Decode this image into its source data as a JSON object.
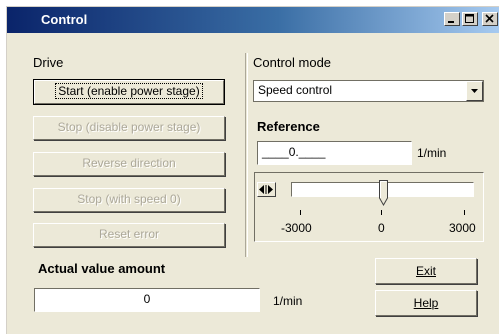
{
  "window": {
    "title": "Control"
  },
  "drive": {
    "heading": "Drive",
    "buttons": [
      {
        "label": "Start (enable power stage)",
        "enabled": true
      },
      {
        "label": "Stop (disable power stage)",
        "enabled": false
      },
      {
        "label": "Reverse direction",
        "enabled": false
      },
      {
        "label": "Stop (with speed 0)",
        "enabled": false
      },
      {
        "label": "Reset error",
        "enabled": false
      }
    ]
  },
  "control_mode": {
    "heading": "Control mode",
    "selected": "Speed control"
  },
  "reference": {
    "heading": "Reference",
    "value": "____0.____",
    "unit": "1/min",
    "slider": {
      "min": -3000,
      "max": 3000,
      "value": 0,
      "min_label": "-3000",
      "mid_label": "0",
      "max_label": "3000"
    }
  },
  "actual": {
    "heading": "Actual value amount",
    "value": "0",
    "unit": "1/min"
  },
  "footer": {
    "exit_label": "Exit",
    "help_label": "Help"
  },
  "colors": {
    "title_start": "#0a246a",
    "title_end": "#a6caf0",
    "face": "#ece9d8",
    "disabled_text": "#aca899"
  }
}
